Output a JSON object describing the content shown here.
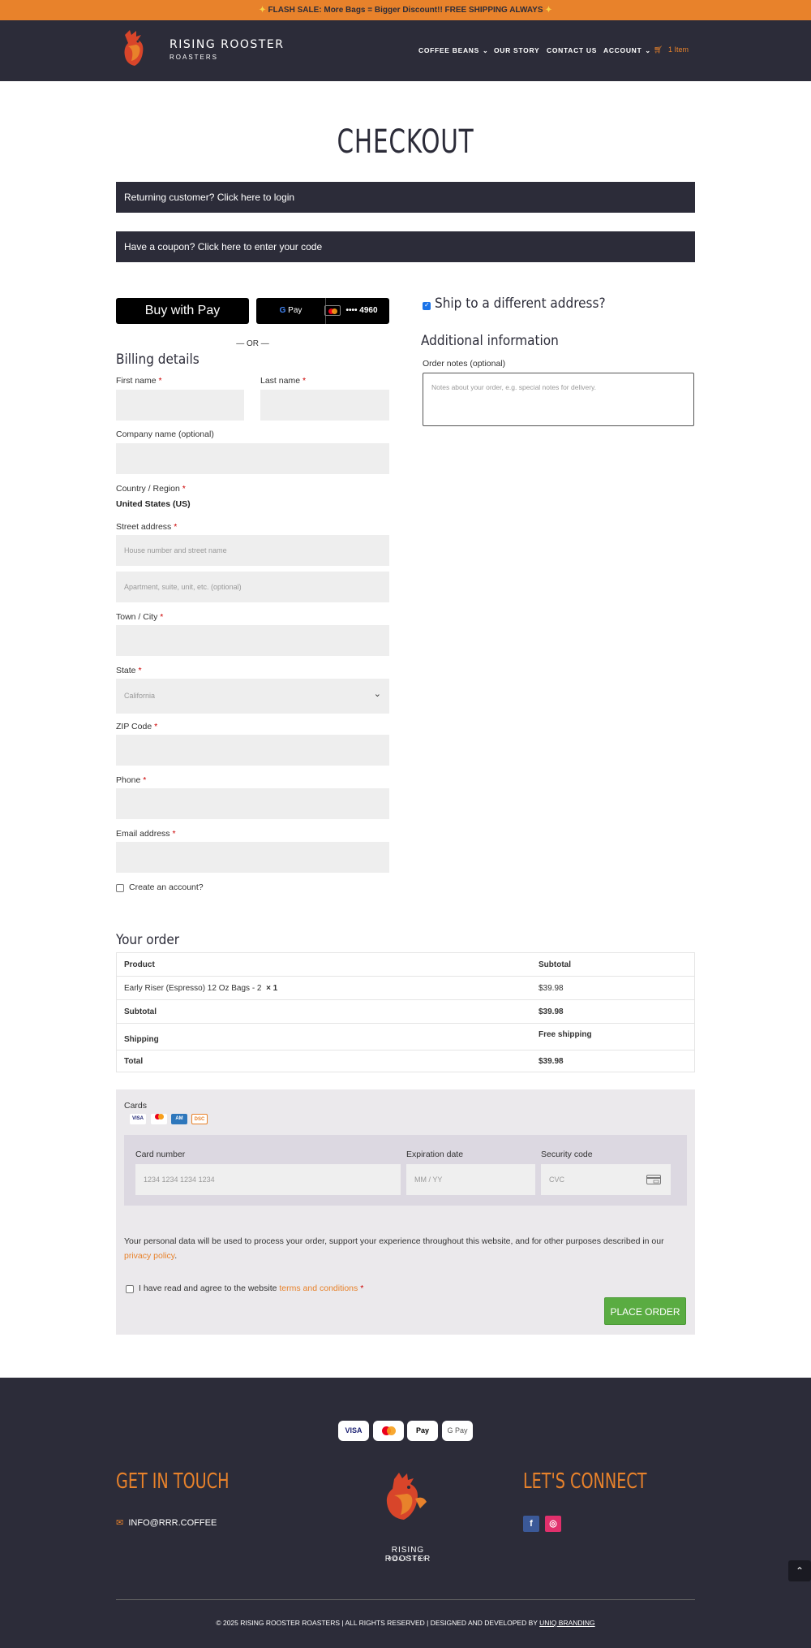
{
  "topbar": {
    "text": "FLASH SALE: More Bags = Bigger Discount!! FREE SHIPPING ALWAYS"
  },
  "brand": {
    "name": "RISING ROOSTER",
    "sub": "ROASTERS"
  },
  "nav": {
    "items": [
      {
        "label": "COFFEE BEANS"
      },
      {
        "label": "OUR STORY"
      },
      {
        "label": "CONTACT US"
      },
      {
        "label": "ACCOUNT"
      }
    ],
    "cart": "1 Item"
  },
  "page": {
    "title": "CHECKOUT"
  },
  "notices": {
    "login": "Returning customer? Click here to login",
    "coupon": "Have a coupon? Click here to enter your code"
  },
  "express": {
    "apple_pay": "Buy with  Pay",
    "google_pay_card": "•••• 4960",
    "or": "— OR —"
  },
  "billing": {
    "heading": "Billing details",
    "first_name": "First name",
    "last_name": "Last name",
    "company": "Company name (optional)",
    "country_label": "Country / Region",
    "country_value": "United States (US)",
    "street_label": "Street address",
    "street_ph1": "House number and street name",
    "street_ph2": "Apartment, suite, unit, etc. (optional)",
    "city": "Town / City",
    "state_label": "State",
    "state_value": "California",
    "zip": "ZIP Code",
    "phone": "Phone",
    "email": "Email address",
    "create_account": "Create an account?"
  },
  "shipping": {
    "ship_diff": "Ship to a different address?",
    "additional": "Additional information",
    "notes_label": "Order notes (optional)",
    "notes_ph": "Notes about your order, e.g. special notes for delivery."
  },
  "order": {
    "heading": "Your order",
    "col_product": "Product",
    "col_subtotal": "Subtotal",
    "item_name": "Early Riser (Espresso) 12 Oz Bags - 2",
    "item_qty": "× 1",
    "item_price": "$39.98",
    "subtotal_label": "Subtotal",
    "subtotal_value": "$39.98",
    "shipping_label": "Shipping",
    "shipping_value": "Free shipping",
    "total_label": "Total",
    "total_value": "$39.98"
  },
  "payment": {
    "cards_label": "Cards",
    "card_number_label": "Card number",
    "card_number_ph": "1234 1234 1234 1234",
    "exp_label": "Expiration date",
    "exp_ph": "MM / YY",
    "cvc_label": "Security code",
    "cvc_ph": "CVC",
    "privacy_text": "Your personal data will be used to process your order, support your experience throughout this website, and for other purposes described in our ",
    "privacy_link": "privacy policy",
    "terms_text": "I have read and agree to the website ",
    "terms_link": "terms and conditions",
    "place_order": "PLACE ORDER"
  },
  "footer": {
    "badges": [
      "VISA",
      "",
      "Pay",
      "G Pay"
    ],
    "get_in_touch": "GET IN TOUCH",
    "email": "INFO@RRR.COFFEE",
    "lets_connect": "LET'S CONNECT",
    "copyright": "© 2025 RISING ROOSTER ROASTERS | ALL RIGHTS RESERVED | DESIGNED AND DEVELOPED BY ",
    "dev_link": "UNIQ BRANDING"
  },
  "colors": {
    "accent": "#e8822b",
    "dark": "#2c2c39",
    "green": "#5aac42"
  }
}
